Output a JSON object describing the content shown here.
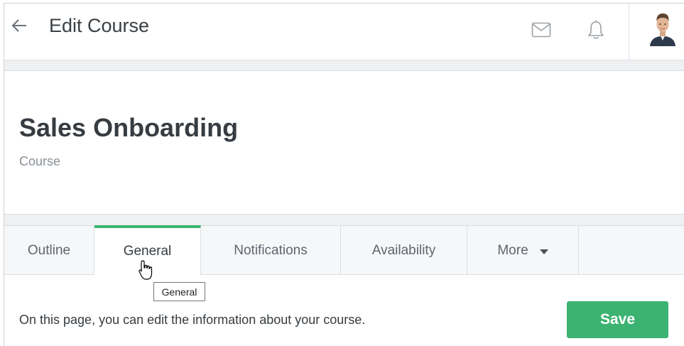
{
  "header": {
    "title": "Edit Course"
  },
  "course": {
    "title": "Sales Onboarding",
    "type": "Course"
  },
  "tabs": [
    {
      "label": "Outline",
      "active": false
    },
    {
      "label": "General",
      "active": true
    },
    {
      "label": "Notifications",
      "active": false
    },
    {
      "label": "Availability",
      "active": false
    },
    {
      "label": "More",
      "active": false
    }
  ],
  "tooltip": {
    "text": "General"
  },
  "footer": {
    "info": "On this page, you can edit the information about your course.",
    "save_label": "Save"
  },
  "icons": {
    "back": "arrow-left-icon",
    "mail": "mail-icon",
    "bell": "bell-icon",
    "more": "caret-down-icon"
  },
  "colors": {
    "accent": "#3cb371",
    "tab_bar": "#f5f7f8",
    "band": "#eef0f2"
  }
}
